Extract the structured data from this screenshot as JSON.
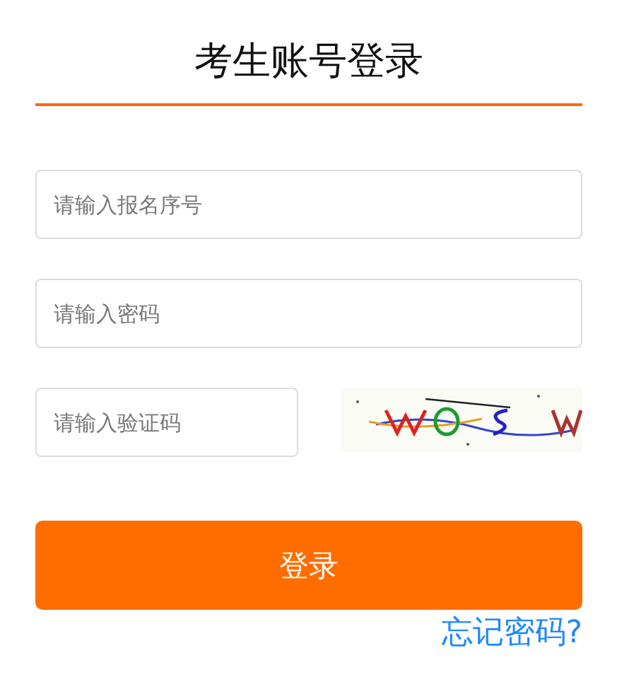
{
  "title": "考生账号登录",
  "fields": [
    {
      "kind": "text",
      "placeholder": "请输入报名序号"
    },
    {
      "kind": "password",
      "placeholder": "请输入密码"
    },
    {
      "kind": "captcha",
      "placeholder": "请输入验证码"
    }
  ],
  "login_button": "登录",
  "forgot_link": "忘记密码?"
}
